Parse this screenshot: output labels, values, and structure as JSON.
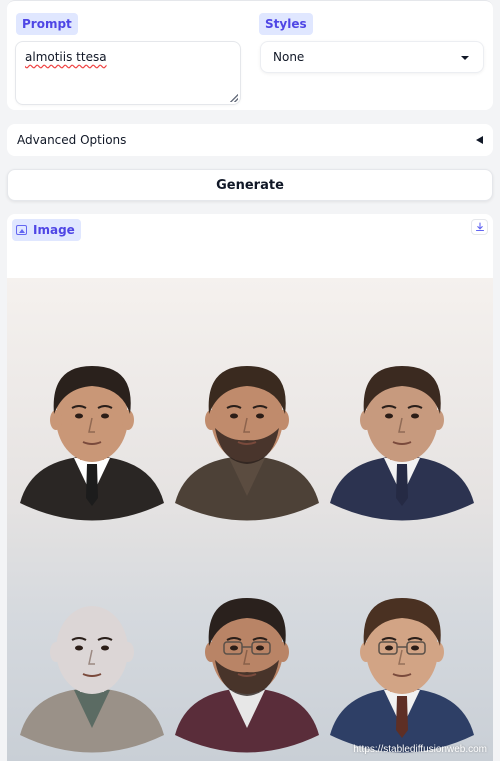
{
  "prompt": {
    "label": "Prompt",
    "value": "almotiis ttesa"
  },
  "styles": {
    "label": "Styles",
    "selected": "None"
  },
  "advanced_options": {
    "label": "Advanced Options",
    "expanded": false
  },
  "generate": {
    "label": "Generate"
  },
  "output": {
    "label": "Image",
    "watermark": "https://stablediffusionweb.com",
    "portraits": [
      {
        "id": "portrait-1",
        "hair": "#2a211c",
        "skin": "#c99777",
        "jacket": "#2a2624",
        "shirt": "#ffffff",
        "tie": "#1c1c1c",
        "beard": false,
        "glasses": false,
        "bald": false
      },
      {
        "id": "portrait-2",
        "hair": "#3a2a1f",
        "skin": "#c08b6c",
        "jacket": "#4d4137",
        "shirt": "#5b4c40",
        "tie": "none",
        "beard": true,
        "glasses": false,
        "bald": false
      },
      {
        "id": "portrait-3",
        "hair": "#3b2a20",
        "skin": "#c79a7e",
        "jacket": "#2c3350",
        "shirt": "#f2f2f2",
        "tie": "#252a44",
        "beard": false,
        "glasses": false,
        "bald": false
      },
      {
        "id": "portrait-4",
        "hair": "none",
        "skin": "#dcd6d6",
        "jacket": "#9a9188",
        "shirt": "#5b6b63",
        "tie": "none",
        "beard": false,
        "glasses": false,
        "bald": true
      },
      {
        "id": "portrait-5",
        "hair": "#2a211d",
        "skin": "#b98466",
        "jacket": "#5a2d3a",
        "shirt": "#e7e7e7",
        "tie": "none",
        "beard": true,
        "glasses": true,
        "bald": false
      },
      {
        "id": "portrait-6",
        "hair": "#4a3122",
        "skin": "#d2a485",
        "jacket": "#2e3f66",
        "shirt": "#f1f1f1",
        "tie": "#5e2f25",
        "beard": false,
        "glasses": true,
        "bald": false
      }
    ]
  }
}
